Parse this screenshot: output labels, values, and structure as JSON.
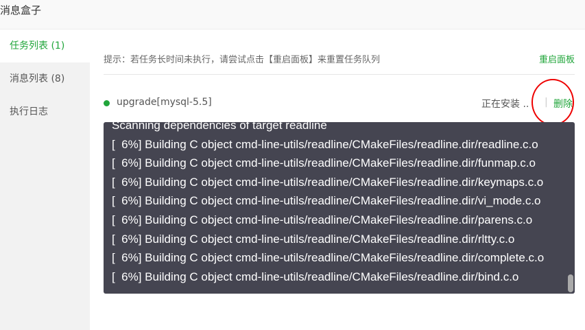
{
  "window": {
    "title": "消息盒子"
  },
  "sidebar": {
    "items": [
      {
        "label": "任务列表 (1)"
      },
      {
        "label": "消息列表 (8)"
      },
      {
        "label": "执行日志"
      }
    ]
  },
  "main": {
    "tip": "提示：若任务长时间未执行，请尝试点击【重启面板】来重置任务队列",
    "restart_label": "重启面板",
    "task": {
      "name": "upgrade[mysql-5.5]",
      "status": "正在安装 ..",
      "separator": "|",
      "delete_label": "删除"
    },
    "console_lines": [
      "Scanning dependencies of target readline",
      "[  6%] Building C object cmd-line-utils/readline/CMakeFiles/readline.dir/readline.c.o",
      "[  6%] Building C object cmd-line-utils/readline/CMakeFiles/readline.dir/funmap.c.o",
      "[  6%] Building C object cmd-line-utils/readline/CMakeFiles/readline.dir/keymaps.c.o",
      "[  6%] Building C object cmd-line-utils/readline/CMakeFiles/readline.dir/vi_mode.c.o",
      "[  6%] Building C object cmd-line-utils/readline/CMakeFiles/readline.dir/parens.c.o",
      "[  6%] Building C object cmd-line-utils/readline/CMakeFiles/readline.dir/rltty.c.o",
      "[  6%] Building C object cmd-line-utils/readline/CMakeFiles/readline.dir/complete.c.o",
      "[  6%] Building C object cmd-line-utils/readline/CMakeFiles/readline.dir/bind.c.o"
    ]
  },
  "colors": {
    "accent": "#20a53a",
    "console_bg": "#454551",
    "highlight_circle": "#e00000"
  }
}
